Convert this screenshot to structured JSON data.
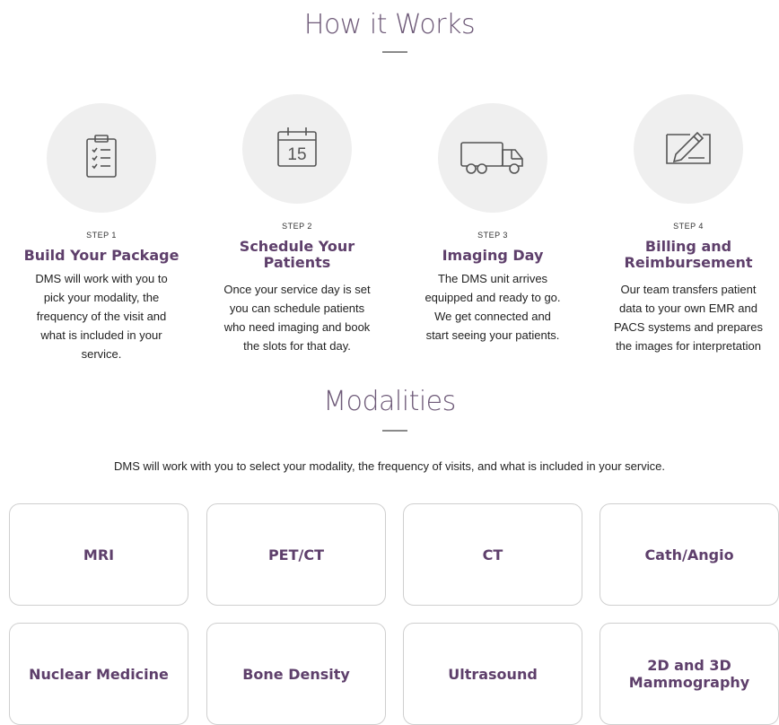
{
  "how_it_works": {
    "title": "How it Works",
    "steps": [
      {
        "step": "STEP 1",
        "heading": "Build Your Package",
        "desc": "DMS will work with you to pick your modality, the frequency of the visit and what is included in your service.",
        "icon": "clipboard-checklist-icon"
      },
      {
        "step": "STEP 2",
        "heading": "Schedule Your Patients",
        "desc": "Once your service day is set you can schedule patients who need imaging and book the slots for that day.",
        "icon": "calendar-icon",
        "calendar_day": "15"
      },
      {
        "step": "STEP 3",
        "heading": "Imaging Day",
        "desc": "The DMS unit arrives equipped and ready to go. We get connected and start seeing your patients.",
        "icon": "truck-icon"
      },
      {
        "step": "STEP 4",
        "heading": "Billing and Reimbursement",
        "desc": "Our team transfers patient data to your own EMR and PACS systems and prepares the images for interpretation",
        "icon": "signature-pen-icon"
      }
    ]
  },
  "modalities": {
    "title": "Modalities",
    "intro": "DMS will work with you to select your modality, the frequency of visits, and what is included in your service.",
    "items": [
      "MRI",
      "PET/CT",
      "CT",
      "Cath/Angio",
      "Nuclear Medicine",
      "Bone Density",
      "Ultrasound",
      "2D and 3D Mammography"
    ]
  },
  "colors": {
    "accent": "#5e3f6b",
    "title": "#6e5a78",
    "circle_bg": "#efefef",
    "card_border": "#cfcfcf"
  }
}
